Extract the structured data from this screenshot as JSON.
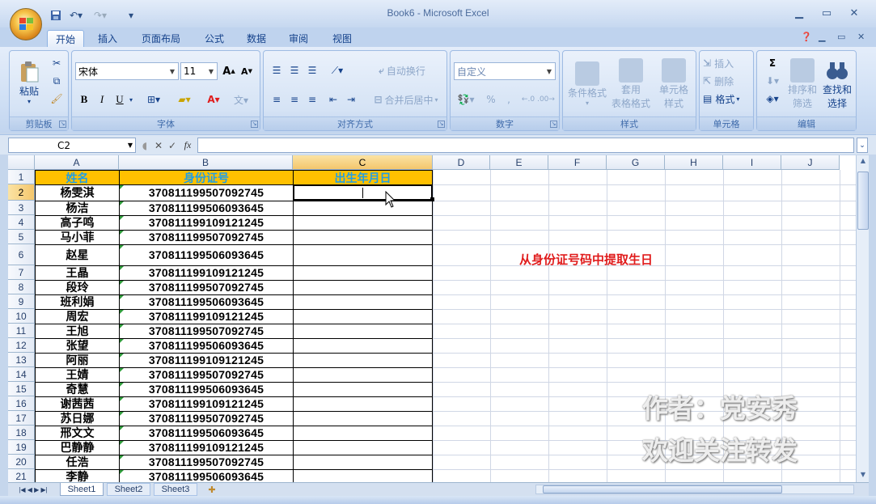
{
  "window": {
    "title": "Book6 - Microsoft Excel"
  },
  "ribbon_tabs": [
    "开始",
    "插入",
    "页面布局",
    "公式",
    "数据",
    "审阅",
    "视图"
  ],
  "clipboard": {
    "paste": "粘贴",
    "group": "剪贴板"
  },
  "font": {
    "name": "宋体",
    "size": "11",
    "group": "字体",
    "bold": "B",
    "italic": "I",
    "underline": "U"
  },
  "alignment": {
    "wrap": "自动换行",
    "merge": "合并后居中",
    "group": "对齐方式"
  },
  "number": {
    "format": "自定义",
    "percent": "%",
    "group": "数字"
  },
  "styles": {
    "cond": "条件格式",
    "table1": "套用",
    "table2": "表格格式",
    "cell1": "单元格",
    "cell2": "样式",
    "group": "样式"
  },
  "cells": {
    "insert": "插入",
    "delete": "删除",
    "format": "格式",
    "group": "单元格"
  },
  "editing": {
    "sum": "Σ",
    "sort1": "排序和",
    "sort2": "筛选",
    "find1": "查找和",
    "find2": "选择",
    "group": "编辑"
  },
  "formula_bar": {
    "name_box": "C2",
    "fx": "fx",
    "content": ""
  },
  "columns": [
    "A",
    "B",
    "C",
    "D",
    "E",
    "F",
    "G",
    "H",
    "I",
    "J"
  ],
  "table": {
    "headers": [
      "姓名",
      "身份证号",
      "出生年月日"
    ],
    "rows": [
      {
        "n": "2",
        "name": "杨雯淇",
        "id": "370811199507092745"
      },
      {
        "n": "3",
        "name": "杨洁",
        "id": "370811199506093645"
      },
      {
        "n": "4",
        "name": "高子鸣",
        "id": "370811199109121245"
      },
      {
        "n": "5",
        "name": "马小菲",
        "id": "370811199507092745"
      },
      {
        "n": "6",
        "name": "赵星",
        "id": "370811199506093645"
      },
      {
        "n": "7",
        "name": "王晶",
        "id": "370811199109121245"
      },
      {
        "n": "8",
        "name": "段玲",
        "id": "370811199507092745"
      },
      {
        "n": "9",
        "name": "班利娟",
        "id": "370811199506093645"
      },
      {
        "n": "10",
        "name": "周宏",
        "id": "370811199109121245"
      },
      {
        "n": "11",
        "name": "王旭",
        "id": "370811199507092745"
      },
      {
        "n": "12",
        "name": "张望",
        "id": "370811199506093645"
      },
      {
        "n": "13",
        "name": "阿丽",
        "id": "370811199109121245"
      },
      {
        "n": "14",
        "name": "王婧",
        "id": "370811199507092745"
      },
      {
        "n": "15",
        "name": "奇慧",
        "id": "370811199506093645"
      },
      {
        "n": "16",
        "name": "谢茜茜",
        "id": "370811199109121245"
      },
      {
        "n": "17",
        "name": "苏日娜",
        "id": "370811199507092745"
      },
      {
        "n": "18",
        "name": "邢文文",
        "id": "370811199506093645"
      },
      {
        "n": "19",
        "name": "巴静静",
        "id": "370811199109121245"
      },
      {
        "n": "20",
        "name": "任浩",
        "id": "370811199507092745"
      },
      {
        "n": "21",
        "name": "李静",
        "id": "370811199506093645"
      }
    ]
  },
  "annotation": "从身份证号码中提取生日",
  "watermark": {
    "line1": "作者：党安秀",
    "line2": "欢迎关注转发"
  },
  "sheets": [
    "Sheet1",
    "Sheet2",
    "Sheet3"
  ],
  "colors": {
    "header_fill": "#ffc000",
    "header_text": "#1f9ee6",
    "annotation": "#e01c1c"
  }
}
